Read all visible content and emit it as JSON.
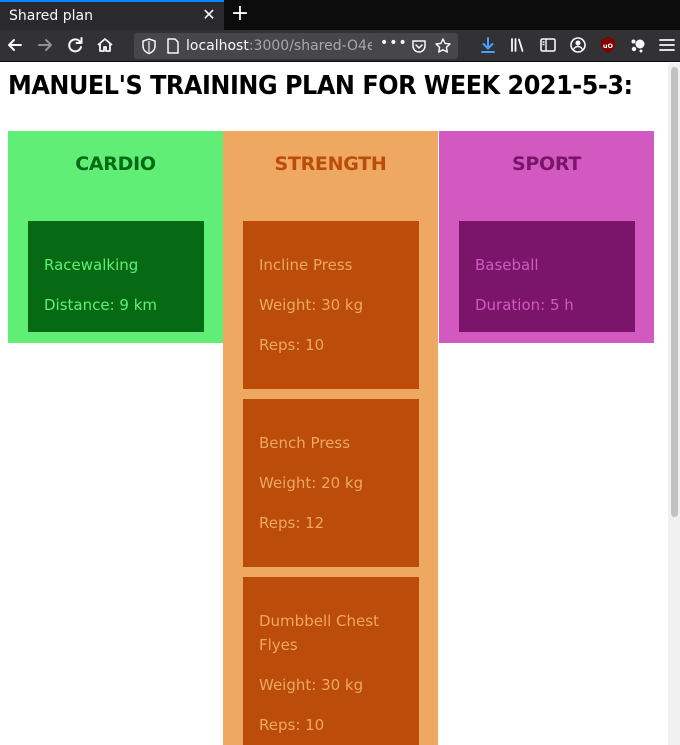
{
  "browser": {
    "tab_title": "Shared plan",
    "url_host": "localhost",
    "url_path": ":3000/shared-O4e",
    "url_more": "•••",
    "theme": {
      "accent": "#0a84ff",
      "download": "#45a1ff",
      "ublock": "#800000"
    }
  },
  "page": {
    "title": "Manuel's training plan for week 2021-5-3:"
  },
  "columns": [
    {
      "id": "cardio",
      "heading": "Cardio",
      "bg": "#61ee76",
      "heading_color": "#056a14",
      "card_bg": "#066a14",
      "card_text": "#61ee76",
      "exercises": [
        {
          "name": "Racewalking",
          "details": [
            "Distance: 9 km"
          ]
        }
      ]
    },
    {
      "id": "strength",
      "heading": "Strength",
      "bg": "#eea861",
      "heading_color": "#bb4c0a",
      "card_bg": "#bb4c0a",
      "card_text": "#eea861",
      "exercises": [
        {
          "name": "Incline Press",
          "details": [
            "Weight: 30 kg",
            "Reps: 10"
          ]
        },
        {
          "name": "Bench Press",
          "details": [
            "Weight: 20 kg",
            "Reps: 12"
          ]
        },
        {
          "name": "Dumbbell Chest Flyes",
          "details": [
            "Weight: 30 kg",
            "Reps: 10"
          ]
        }
      ]
    },
    {
      "id": "sport",
      "heading": "Sport",
      "bg": "#d259c0",
      "heading_color": "#7a156a",
      "card_bg": "#7a156a",
      "card_text": "#d259c0",
      "exercises": [
        {
          "name": "Baseball",
          "details": [
            "Duration: 5 h"
          ]
        }
      ]
    }
  ]
}
